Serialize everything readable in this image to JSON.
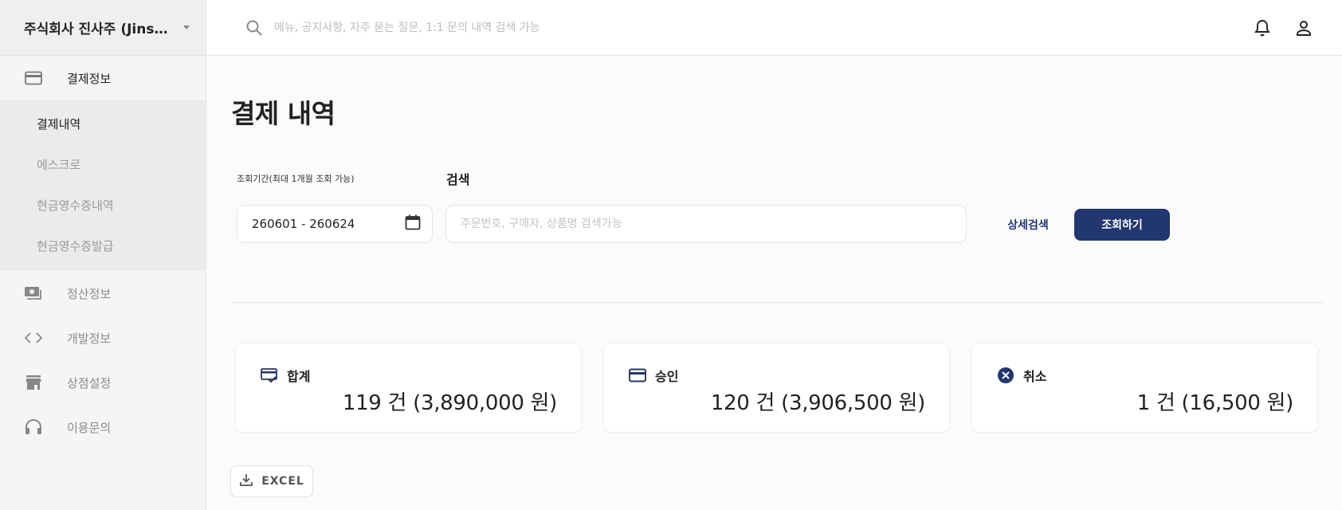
{
  "sidebar": {
    "company": "주식회사 진사주 (Jinsaju)",
    "items": [
      {
        "label": "결제정보",
        "icon": "credit-card-icon"
      },
      {
        "label": "정산정보",
        "icon": "cash-icon"
      },
      {
        "label": "개발정보",
        "icon": "code-icon"
      },
      {
        "label": "상점설정",
        "icon": "store-icon"
      },
      {
        "label": "이용문의",
        "icon": "headset-icon"
      }
    ],
    "subitems": [
      "결제내역",
      "에스크로",
      "현금영수증내역",
      "현금영수증발급"
    ]
  },
  "topbar": {
    "search_placeholder": "메뉴, 공지사항, 자주 묻는 질문, 1:1 문의 내역 검색 가능"
  },
  "main": {
    "title": "결제 내역",
    "period_label": "조회기간(최대 1개월 조회 가능)",
    "search_label": "검색",
    "date_range": "260601 - 260624",
    "search_placeholder": "주문번호, 구매자, 상품명 검색가능",
    "detail_search": "상세검색",
    "query_button": "조회하기",
    "excel_button": "EXCEL"
  },
  "summary": {
    "total": {
      "label": "합계",
      "value": "119 건 (3,890,000 원)"
    },
    "approved": {
      "label": "승인",
      "value": "120 건 (3,906,500 원)"
    },
    "cancelled": {
      "label": "취소",
      "value": "1 건 (16,500 원)"
    }
  },
  "colors": {
    "primary": "#223670",
    "sidebar_bg": "#f5f5f5"
  }
}
